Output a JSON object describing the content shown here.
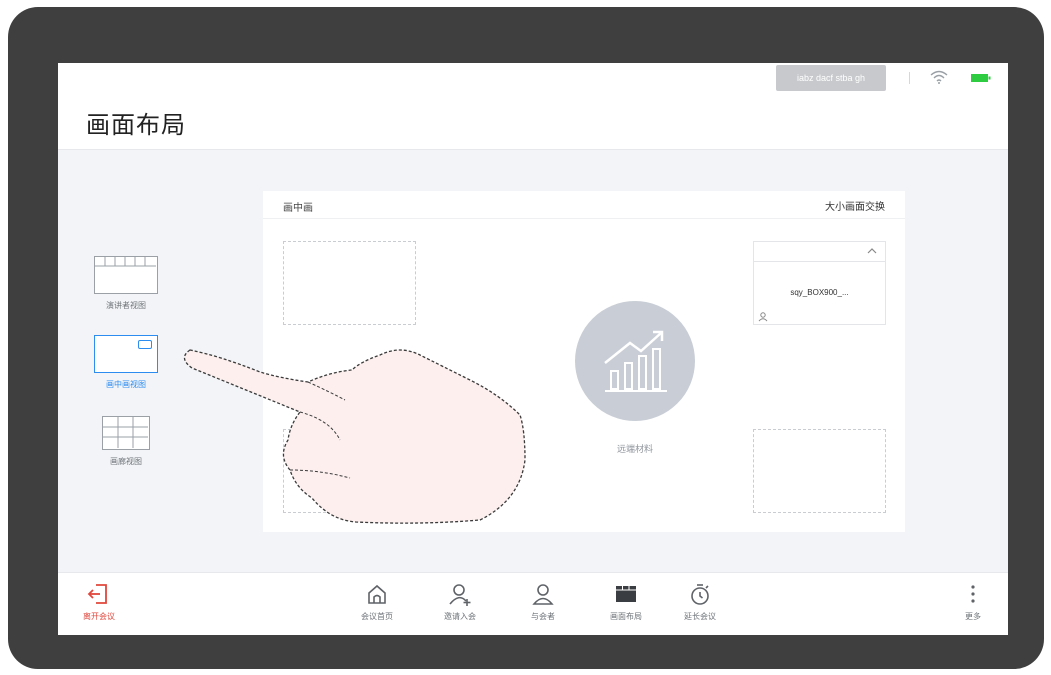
{
  "status_bar": {
    "account": "iabz dacf stba gh",
    "icons": [
      "wifi-icon",
      "battery-icon"
    ],
    "battery_color": "#2ecc40"
  },
  "header": {
    "title": "画面布局"
  },
  "layout_options": [
    {
      "label": "演讲者视图",
      "icon": "speaker-view-icon",
      "active": false
    },
    {
      "label": "画中画视图",
      "icon": "picture-in-picture-icon",
      "active": true
    },
    {
      "label": "画廊视图",
      "icon": "gallery-view-icon",
      "active": false
    }
  ],
  "preview": {
    "mode_label": "画中画",
    "swap_label": "大小画面交换",
    "pip_name": "sqy_BOX900_...",
    "material_label": "远端材料"
  },
  "toolbar": {
    "leave": "离开会议",
    "home": "会议首页",
    "invite": "邀请入会",
    "participants": "与会者",
    "layout": "画面布局",
    "extend": "延长会议",
    "more": "更多"
  },
  "colors": {
    "accent": "#2d8cf0",
    "danger": "#e0473d",
    "bezel": "#3f3f3f"
  }
}
